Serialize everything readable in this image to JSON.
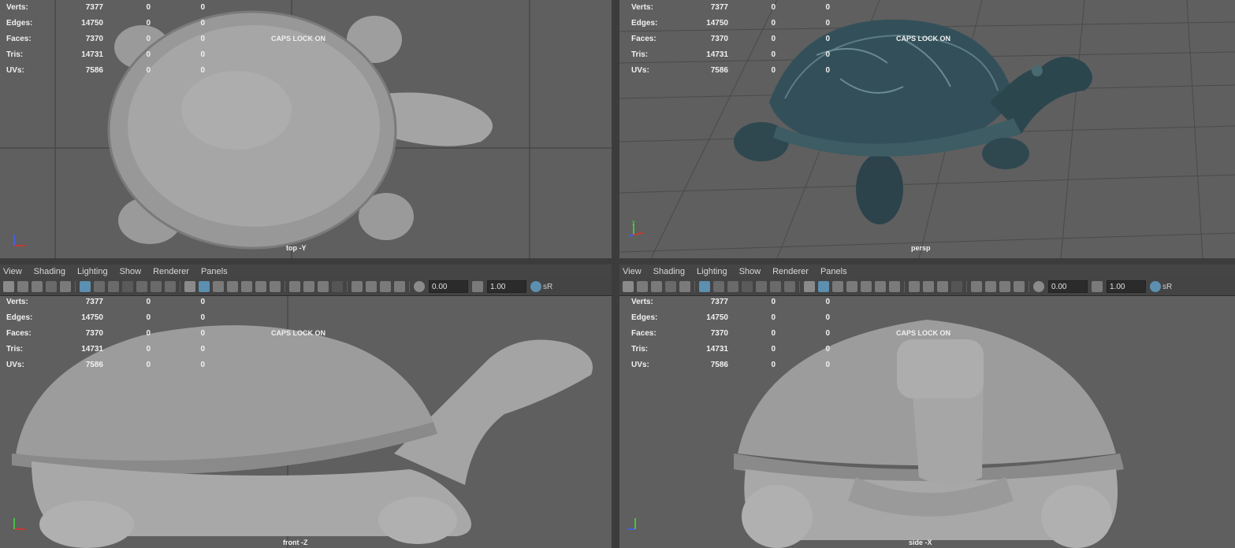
{
  "menus": {
    "left": [
      "View",
      "Shading",
      "Lighting",
      "Show",
      "Renderer",
      "Panels"
    ],
    "right": [
      "View",
      "Shading",
      "Lighting",
      "Show",
      "Renderer",
      "Panels"
    ]
  },
  "toolbar": {
    "exposure": "0.00",
    "gamma": "1.00",
    "colorspace_label": "sR"
  },
  "stats": {
    "labels": [
      "Verts:",
      "Edges:",
      "Faces:",
      "Tris:",
      "UVs:"
    ],
    "values": [
      [
        "7377",
        "0",
        "0"
      ],
      [
        "14750",
        "0",
        "0"
      ],
      [
        "7370",
        "0",
        "0"
      ],
      [
        "14731",
        "0",
        "0"
      ],
      [
        "7586",
        "0",
        "0"
      ]
    ]
  },
  "caps_lock": "CAPS LOCK ON",
  "viewports": {
    "top": "top -Y",
    "persp": "persp",
    "front": "front -Z",
    "side": "side -X"
  },
  "axis_labels": {
    "x": "x",
    "y": "y",
    "z": "z"
  },
  "colors": {
    "viewport_bg": "#5f5f5f",
    "grid_line": "#3e3e3e",
    "menu_bg": "#454545",
    "toolbar_bg": "#444444",
    "turtle_shaded": "#a8a8a8",
    "turtle_textured": "#2e4a54",
    "axis_x": "#e0302a",
    "axis_y": "#40e040",
    "axis_z": "#4060ff"
  }
}
